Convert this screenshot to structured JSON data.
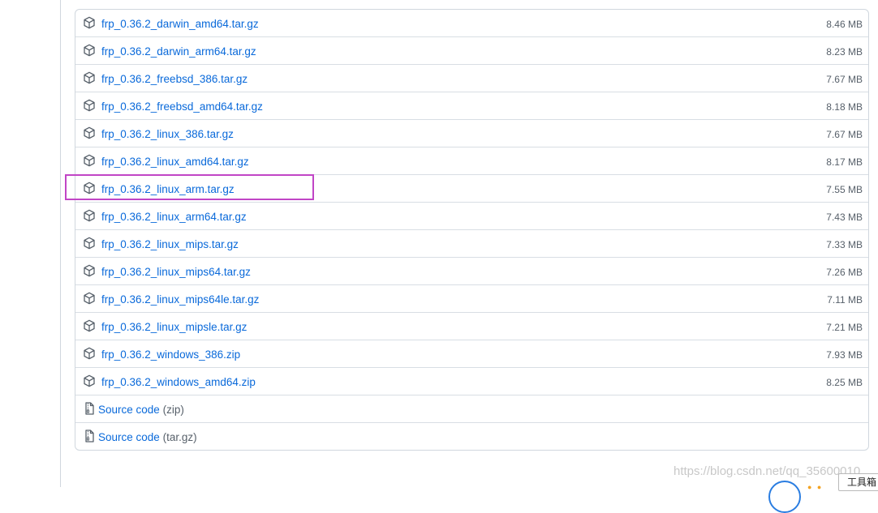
{
  "assets": [
    {
      "name": "frp_0.36.2_darwin_amd64.tar.gz",
      "size": "8.46 MB"
    },
    {
      "name": "frp_0.36.2_darwin_arm64.tar.gz",
      "size": "8.23 MB"
    },
    {
      "name": "frp_0.36.2_freebsd_386.tar.gz",
      "size": "7.67 MB"
    },
    {
      "name": "frp_0.36.2_freebsd_amd64.tar.gz",
      "size": "8.18 MB"
    },
    {
      "name": "frp_0.36.2_linux_386.tar.gz",
      "size": "7.67 MB"
    },
    {
      "name": "frp_0.36.2_linux_amd64.tar.gz",
      "size": "8.17 MB"
    },
    {
      "name": "frp_0.36.2_linux_arm.tar.gz",
      "size": "7.55 MB"
    },
    {
      "name": "frp_0.36.2_linux_arm64.tar.gz",
      "size": "7.43 MB"
    },
    {
      "name": "frp_0.36.2_linux_mips.tar.gz",
      "size": "7.33 MB"
    },
    {
      "name": "frp_0.36.2_linux_mips64.tar.gz",
      "size": "7.26 MB"
    },
    {
      "name": "frp_0.36.2_linux_mips64le.tar.gz",
      "size": "7.11 MB"
    },
    {
      "name": "frp_0.36.2_linux_mipsle.tar.gz",
      "size": "7.21 MB"
    },
    {
      "name": "frp_0.36.2_windows_386.zip",
      "size": "7.93 MB"
    },
    {
      "name": "frp_0.36.2_windows_amd64.zip",
      "size": "8.25 MB"
    }
  ],
  "source_code": [
    {
      "label": "Source code",
      "ext": "(zip)"
    },
    {
      "label": "Source code",
      "ext": "(tar.gz)"
    }
  ],
  "watermark": "https://blog.csdn.net/qq_35600010",
  "toolbox_label": "工具箱",
  "colors": {
    "link": "#0969da",
    "muted": "#57606a",
    "highlight": "#c145c6",
    "border": "#d0d7de"
  },
  "icons": {
    "asset": "package-icon",
    "source": "file-zip-icon"
  }
}
